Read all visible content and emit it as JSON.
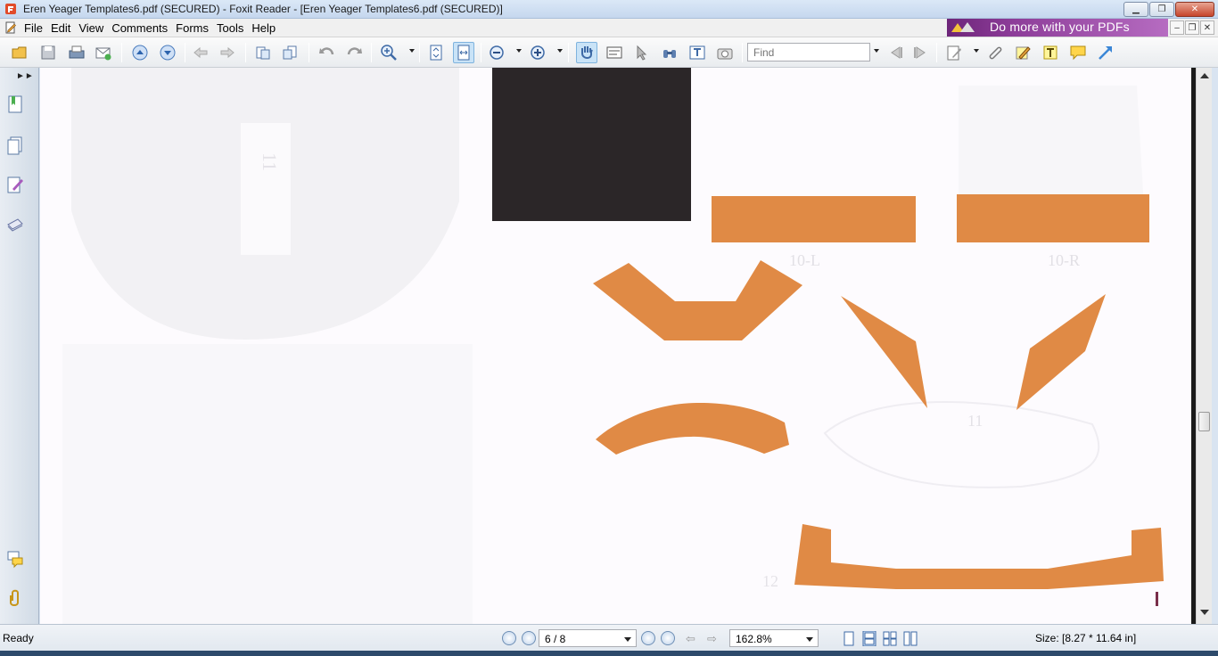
{
  "window": {
    "title": "Eren Yeager Templates6.pdf (SECURED) - Foxit Reader - [Eren Yeager Templates6.pdf (SECURED)]"
  },
  "menu": {
    "items": [
      "File",
      "Edit",
      "View",
      "Comments",
      "Forms",
      "Tools",
      "Help"
    ]
  },
  "promo": {
    "text": "Do more with your PDFs"
  },
  "toolbar": {
    "find_placeholder": "Find",
    "icons": [
      "open-icon",
      "save-icon",
      "print-icon",
      "email-icon",
      "previous-page-icon",
      "next-page-icon",
      "go-back-icon",
      "go-forward-icon",
      "zoom-in-icon",
      "fit-page-icon",
      "fit-width-icon",
      "zoom-out-circle-icon",
      "zoom-in-circle-icon",
      "hand-tool-icon",
      "select-text-icon",
      "select-annotation-icon",
      "find-binoculars-icon",
      "typewriter-icon",
      "snapshot-icon",
      "previous-result-icon",
      "next-result-icon",
      "note-icon",
      "attachment-icon",
      "highlight-icon",
      "text-box-icon",
      "comment-icon",
      "arrow-tool-icon"
    ]
  },
  "document": {
    "colors": {
      "orange": "#e08a45",
      "dark": "#2b2628",
      "paper": "#fdfbfe"
    },
    "faint_labels": [
      "11",
      "11",
      "10-R",
      "10-L",
      "12"
    ]
  },
  "status": {
    "ready": "Ready",
    "page": "6 / 8",
    "zoom": "162.8%",
    "size": "Size: [8.27 * 11.64 in]"
  }
}
